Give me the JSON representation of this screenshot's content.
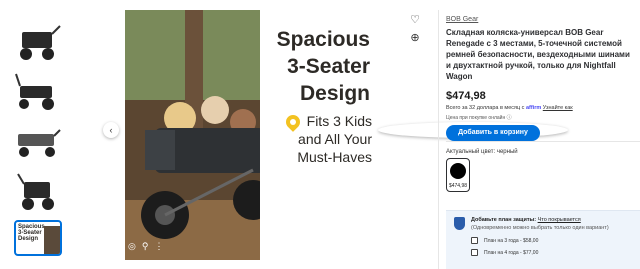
{
  "gallery": {
    "headline": [
      "Spacious",
      "3-Seater",
      "Design"
    ],
    "feature": "Fits 3 Kids and All Your Must-Haves",
    "selected_thumb_text": "Spacious 3-Seater Design"
  },
  "product": {
    "brand": "BOB Gear",
    "title": "Складная коляска-универсал BOB Gear Renegade с 3 местами, 5-точечной системой ремней безопасности, вездеходными шинами и двухтактной ручкой, только для Nightfall Wagon",
    "price": "$474,98",
    "financing_text": "Всего за 32 доллара в месяц с",
    "financing_brand": "affirm",
    "financing_link": "Узнайте как",
    "online_price_note": "Цена при покупке онлайн",
    "add_to_cart": "Добавить в корзину"
  },
  "color": {
    "label": "Актуальный цвет: черный",
    "swatch_price": "$474,98",
    "value": "#000000"
  },
  "protection": {
    "title": "Добавьте план защиты:",
    "link": "Что покрывается",
    "subtitle": "(Одновременно можно выбрать только один вариант)",
    "options": [
      "План на 3 года - $58,00",
      "План на 4 года - $77,00"
    ]
  },
  "colors": {
    "accent": "#0071dc",
    "protection_bg": "#eef4fb"
  }
}
